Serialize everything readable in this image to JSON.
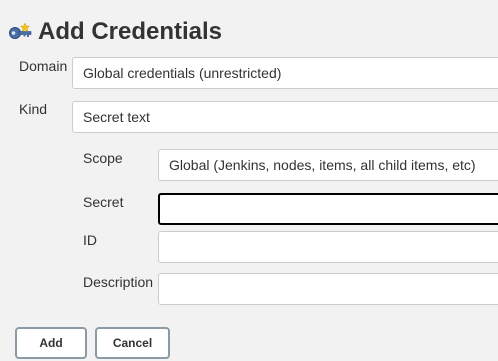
{
  "header": {
    "title": "Add Credentials",
    "icon": "key-icon"
  },
  "form": {
    "domain": {
      "label": "Domain",
      "value": "Global credentials (unrestricted)"
    },
    "kind": {
      "label": "Kind",
      "value": "Secret text"
    },
    "scope": {
      "label": "Scope",
      "value": "Global (Jenkins, nodes, items, all child items, etc)"
    },
    "secret": {
      "label": "Secret",
      "value": ""
    },
    "id": {
      "label": "ID",
      "value": ""
    },
    "description": {
      "label": "Description",
      "value": ""
    }
  },
  "actions": {
    "add_label": "Add",
    "cancel_label": "Cancel"
  },
  "colors": {
    "background": "#f2f2f2",
    "field_border": "#cccccc",
    "focused_border": "#000000",
    "button_border": "#8a9aa6"
  }
}
